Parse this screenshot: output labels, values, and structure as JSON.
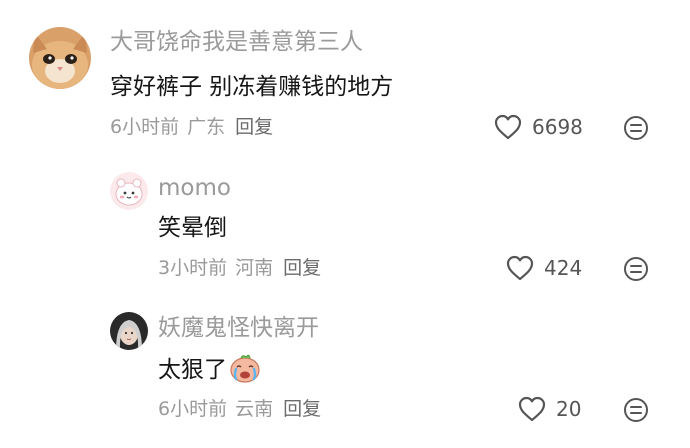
{
  "comments": [
    {
      "username": "大哥饶命我是善意第三人",
      "text": "穿好裤子 别冻着赚钱的地方",
      "time": "6小时前",
      "location": "广东",
      "reply_label": "回复",
      "likes": "6698"
    },
    {
      "username": "momo",
      "text": "笑晕倒",
      "time": "3小时前",
      "location": "河南",
      "reply_label": "回复",
      "likes": "424"
    },
    {
      "username": "妖魔鬼怪快离开",
      "text": "太狠了",
      "time": "6小时前",
      "location": "云南",
      "reply_label": "回复",
      "likes": "20",
      "emoji": "crying-face-emoji"
    }
  ],
  "icons": {
    "like": "heart-outline-icon",
    "more": "more-options-icon"
  },
  "colors": {
    "text": "#161616",
    "muted": "#9a9a9a",
    "icon": "#555555"
  }
}
